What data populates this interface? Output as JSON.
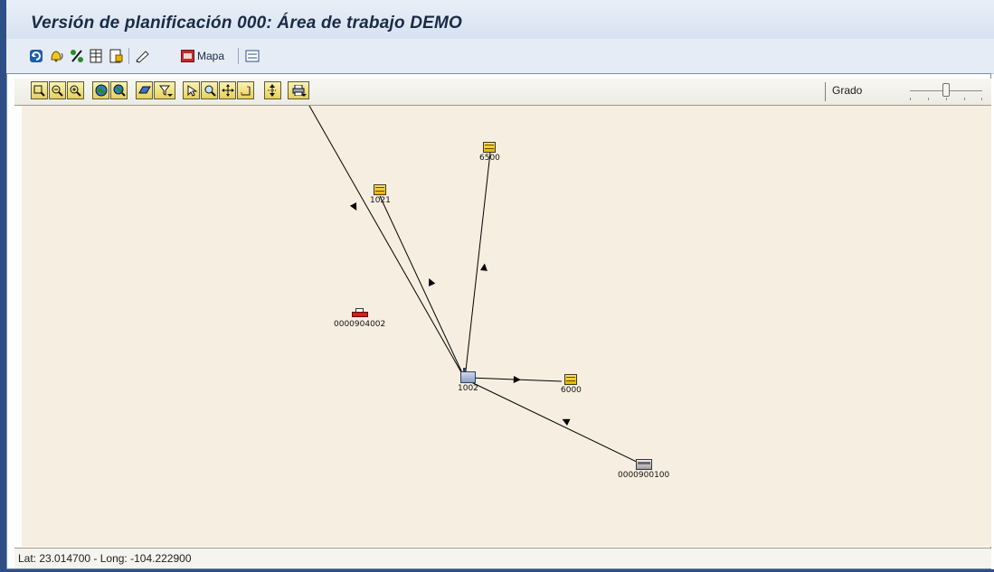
{
  "window": {
    "title": "Versión de planificación 000: Área de trabajo DEMO"
  },
  "app_toolbar": {
    "buttons": [
      {
        "name": "refresh-icon",
        "glyph": "⟳"
      },
      {
        "name": "alert-bell-icon",
        "glyph": "🔔"
      },
      {
        "name": "percent-icon",
        "glyph": "%"
      },
      {
        "name": "table-icon",
        "glyph": "▤"
      },
      {
        "name": "document-icon",
        "glyph": "▯"
      },
      {
        "name": "pencil-icon",
        "glyph": "✎"
      }
    ],
    "map_label": "Mapa",
    "list_icon": "list-icon"
  },
  "map_toolbar": {
    "buttons": [
      {
        "name": "zoom-window-icon",
        "glyph": "⌕"
      },
      {
        "name": "zoom-out-icon",
        "glyph": "−"
      },
      {
        "name": "zoom-in-icon",
        "glyph": "+"
      },
      {
        "name": "globe-icon",
        "glyph": "◉"
      },
      {
        "name": "globe-zoom-icon",
        "glyph": "◍"
      },
      {
        "name": "layer-icon",
        "glyph": "▱"
      },
      {
        "name": "filter-icon",
        "glyph": "▽"
      },
      {
        "name": "select-pointer-icon",
        "glyph": "↖"
      },
      {
        "name": "find-icon",
        "glyph": "⌕"
      },
      {
        "name": "pan-icon",
        "glyph": "✥"
      },
      {
        "name": "measure-icon",
        "glyph": "⌐"
      },
      {
        "name": "distance-icon",
        "glyph": "⇕"
      },
      {
        "name": "print-icon",
        "glyph": "⎙"
      }
    ],
    "zoom_label": "Grado",
    "zoom_level": 0.5
  },
  "map": {
    "background": "#f6eee0",
    "nodes": [
      {
        "id": "6500",
        "label": "6500",
        "type": "warehouse"
      },
      {
        "id": "1021",
        "label": "1021",
        "type": "warehouse"
      },
      {
        "id": "0000904002",
        "label": "0000904002",
        "type": "truck"
      },
      {
        "id": "1002",
        "label": "1002",
        "type": "plant"
      },
      {
        "id": "6000",
        "label": "6000",
        "type": "warehouse"
      },
      {
        "id": "0000900100",
        "label": "0000900100",
        "type": "customer"
      }
    ],
    "links": [
      {
        "from": "1002",
        "to": "6500"
      },
      {
        "from": "1002",
        "to": "1021"
      },
      {
        "from": "1002",
        "to": "6000"
      },
      {
        "from": "0000900100",
        "to": "1002"
      },
      {
        "from": "offmap",
        "to": "1002"
      }
    ]
  },
  "status": {
    "coords": "Lat: 23.014700 - Long: -104.222900"
  }
}
